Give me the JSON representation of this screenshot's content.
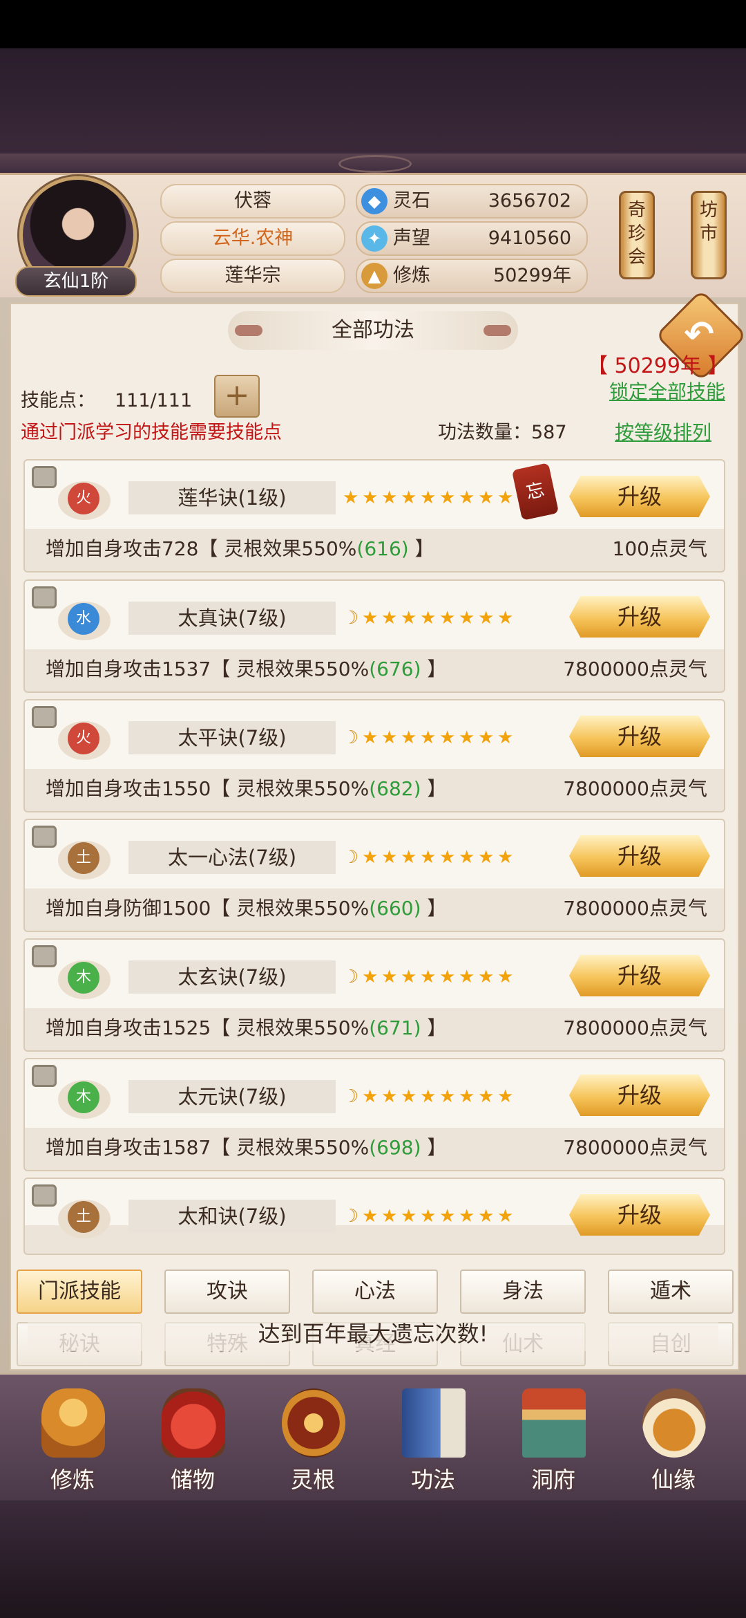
{
  "header": {
    "rank_badge": "玄仙1阶",
    "player_name": "伏蓉",
    "title": "云华.农神",
    "sect": "莲华宗",
    "resources": [
      {
        "label": "灵石",
        "value": "3656702",
        "icon": "spirit-stone-icon"
      },
      {
        "label": "声望",
        "value": "9410560",
        "icon": "reputation-icon"
      },
      {
        "label": "修炼",
        "value": "50299年",
        "icon": "cultivation-icon"
      }
    ],
    "side_buttons": [
      "奇珍会",
      "坊市"
    ]
  },
  "panel": {
    "title": "全部功法",
    "year_display": "【 50299年 】",
    "lock_all": "锁定全部技能",
    "skill_points_label": "技能点：",
    "skill_points_value": "111/111",
    "notice": "通过门派学习的技能需要技能点",
    "count_label": "功法数量：587",
    "sort_link": "按等级排列"
  },
  "skills": [
    {
      "element": "火",
      "name": "莲华诀(1级)",
      "button": "升级",
      "desc_prefix": "增加自身攻击728【 灵根效果550%",
      "desc_value": "(616)",
      "desc_suffix": " 】",
      "cost": "100点灵气",
      "forget_tag": "忘"
    },
    {
      "element": "水",
      "name": "太真诀(7级)",
      "button": "升级",
      "desc_prefix": "增加自身攻击1537【 灵根效果550%",
      "desc_value": "(676)",
      "desc_suffix": " 】",
      "cost": "7800000点灵气"
    },
    {
      "element": "火",
      "name": "太平诀(7级)",
      "button": "升级",
      "desc_prefix": "增加自身攻击1550【 灵根效果550%",
      "desc_value": "(682)",
      "desc_suffix": " 】",
      "cost": "7800000点灵气"
    },
    {
      "element": "土",
      "name": "太一心法(7级)",
      "button": "升级",
      "desc_prefix": "增加自身防御1500【 灵根效果550%",
      "desc_value": "(660)",
      "desc_suffix": " 】",
      "cost": "7800000点灵气"
    },
    {
      "element": "木",
      "name": "太玄诀(7级)",
      "button": "升级",
      "desc_prefix": "增加自身攻击1525【 灵根效果550%",
      "desc_value": "(671)",
      "desc_suffix": " 】",
      "cost": "7800000点灵气"
    },
    {
      "element": "木",
      "name": "太元诀(7级)",
      "button": "升级",
      "desc_prefix": "增加自身攻击1587【 灵根效果550%",
      "desc_value": "(698)",
      "desc_suffix": " 】",
      "cost": "7800000点灵气"
    },
    {
      "element": "土",
      "name": "太和诀(7级)",
      "button": "升级"
    }
  ],
  "tabs_row1": [
    "门派技能",
    "攻诀",
    "心法",
    "身法",
    "遁术"
  ],
  "tabs_row2": [
    "秘诀",
    "特殊",
    "真经",
    "仙术",
    "自创"
  ],
  "toast": "达到百年最大遗忘次数!",
  "bottom_nav": [
    {
      "label": "修炼",
      "icon": "cultivation-figure-icon"
    },
    {
      "label": "储物",
      "icon": "storage-bag-icon"
    },
    {
      "label": "灵根",
      "icon": "spirit-root-icon"
    },
    {
      "label": "功法",
      "icon": "skill-book-icon"
    },
    {
      "label": "洞府",
      "icon": "cave-dwelling-icon"
    },
    {
      "label": "仙缘",
      "icon": "immortal-fate-icon"
    }
  ],
  "colors": {
    "accent_gold": "#f6c45a",
    "link_green": "#2e9c3a",
    "warning_red": "#c21515"
  }
}
